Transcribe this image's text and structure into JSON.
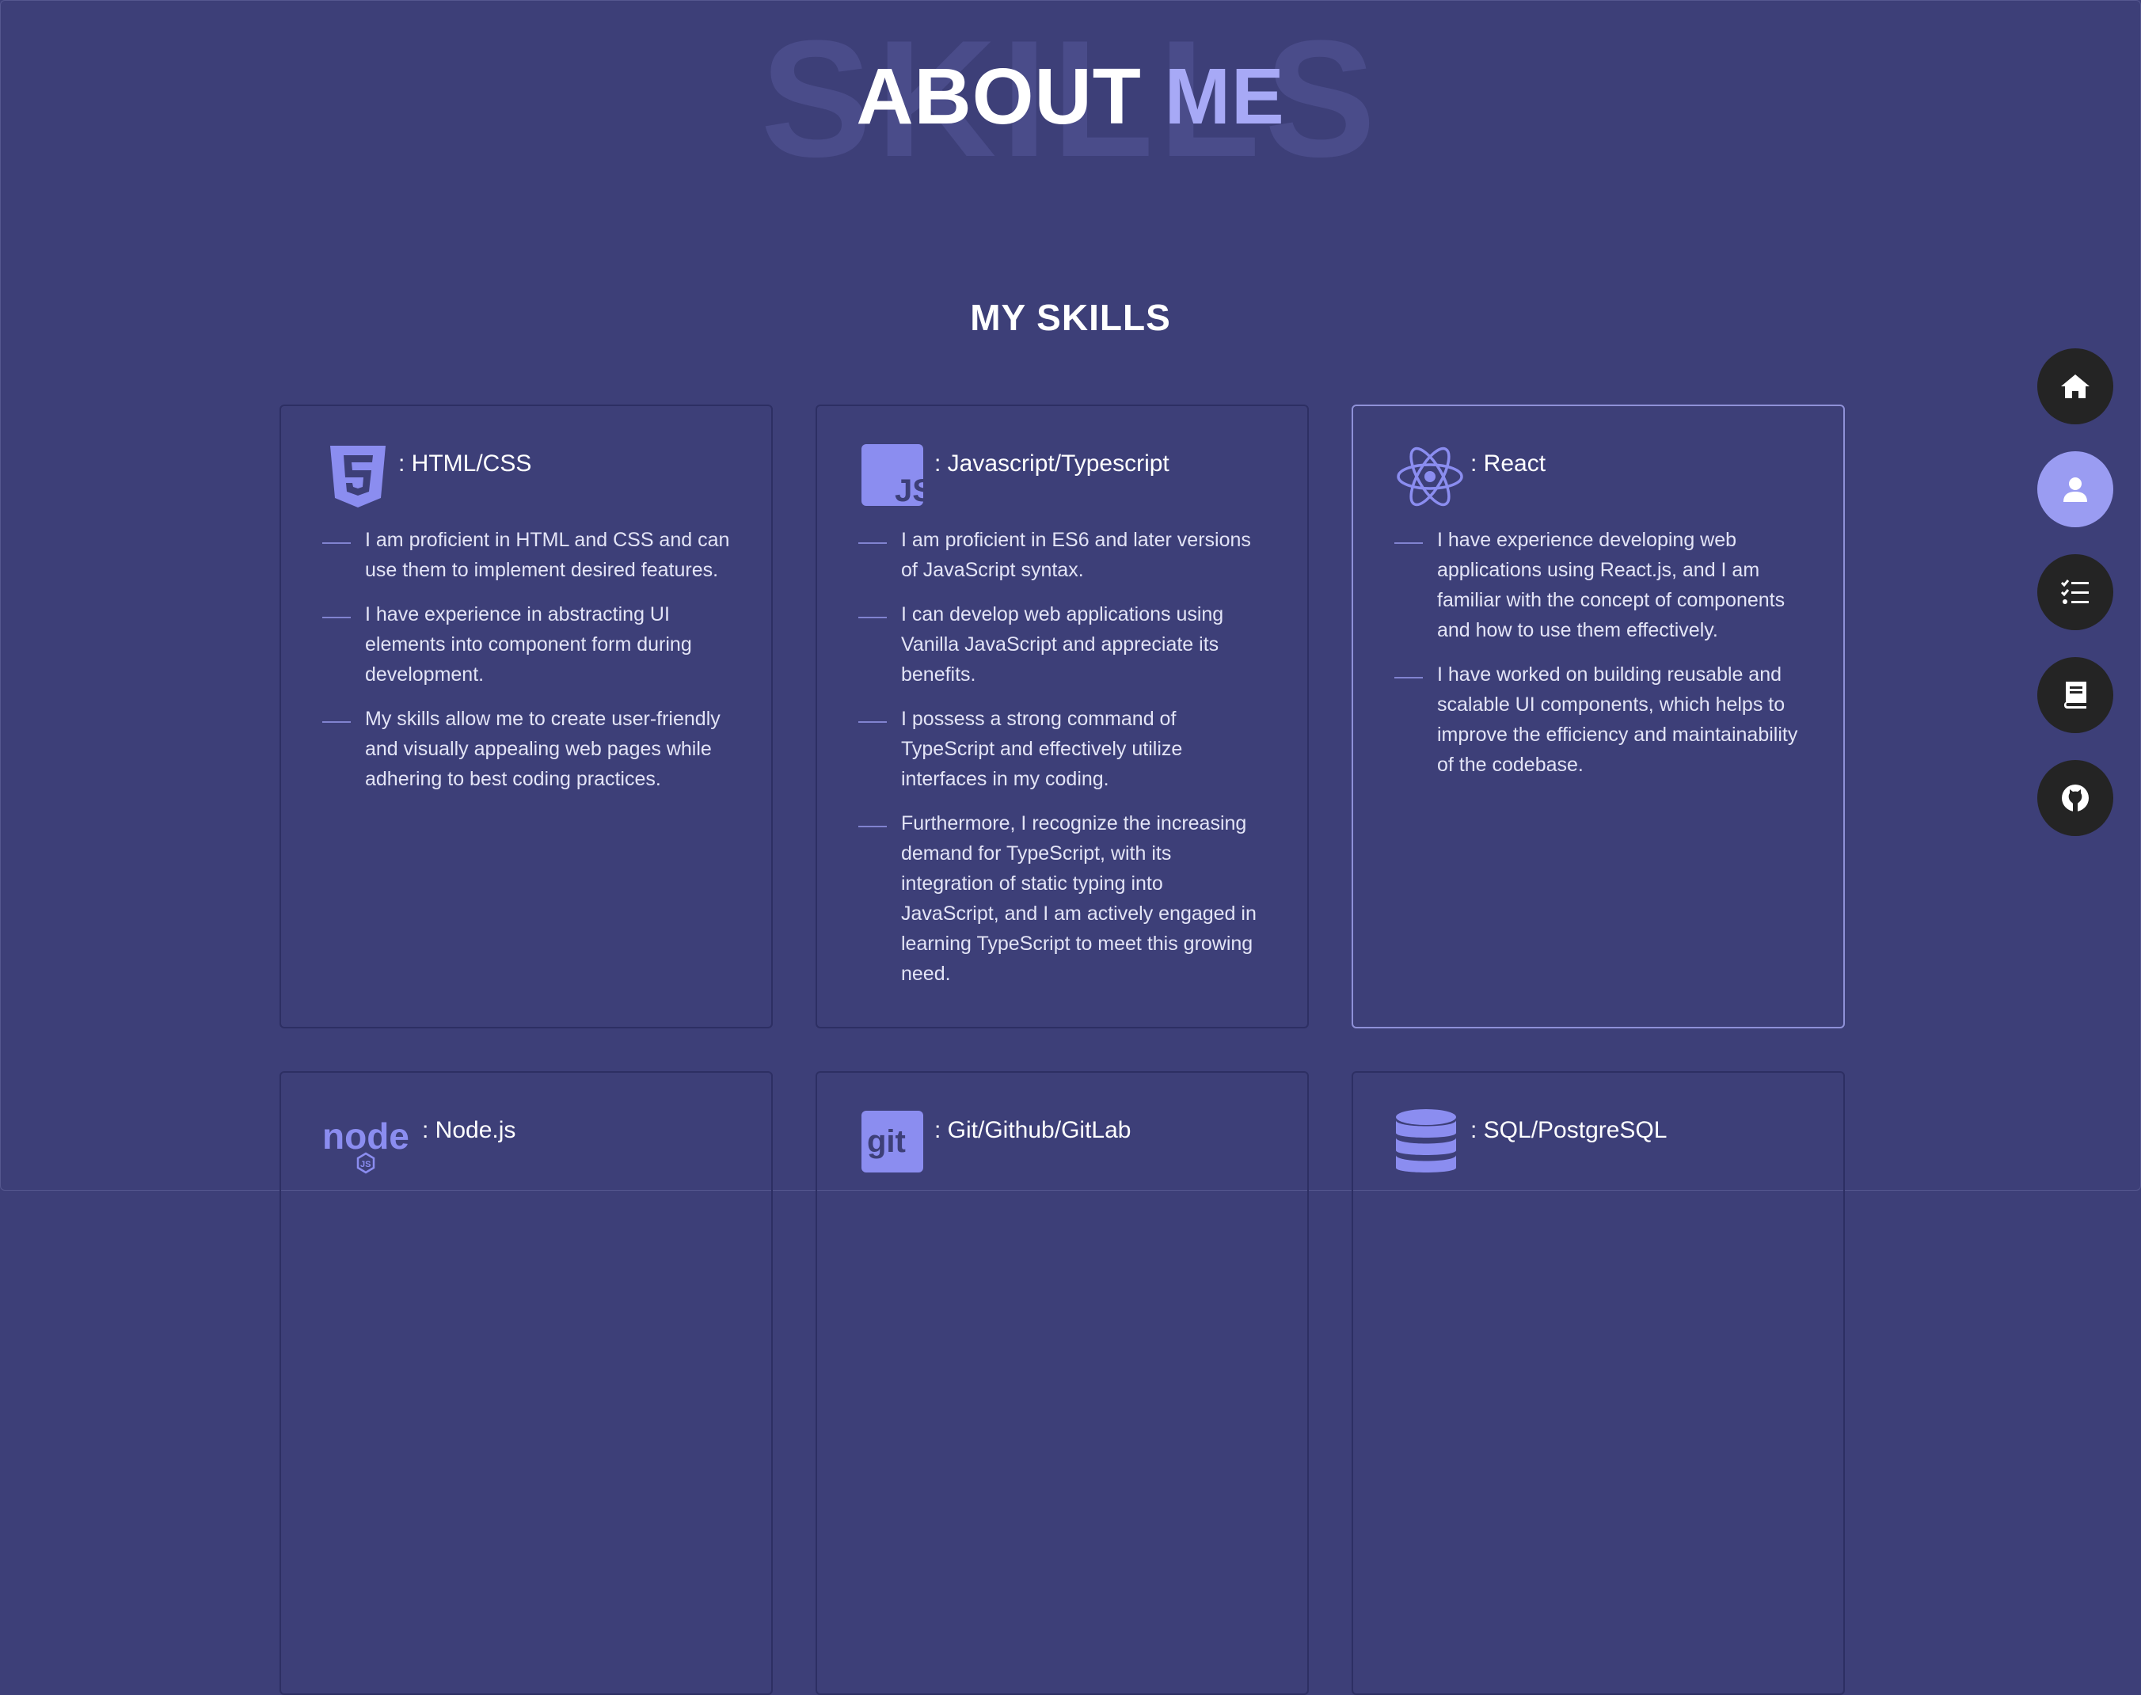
{
  "header": {
    "background_word": "SKILLS",
    "title_part1": "ABOUT",
    "title_part2": "ME"
  },
  "section_title": "MY SKILLS",
  "colors": {
    "background": "#3d3f78",
    "accent": "#a7a9f6",
    "card_border_active": "#8f91d8",
    "nav_button": "#242424",
    "nav_button_active": "#9a9cf2"
  },
  "skills": [
    {
      "icon": "html5-icon",
      "title": ": HTML/CSS",
      "items": [
        "I am proficient in HTML and CSS and can use them to implement desired features.",
        "I have experience in abstracting UI elements into component form during development.",
        "My skills allow me to create user-friendly and visually appealing web pages while adhering to best coding practices."
      ]
    },
    {
      "icon": "javascript-icon",
      "title": ": Javascript/Typescript",
      "items": [
        "I am proficient in ES6 and later versions of JavaScript syntax.",
        "I can develop web applications using Vanilla JavaScript and appreciate its benefits.",
        "I possess a strong command of TypeScript and effectively utilize interfaces in my coding.",
        "Furthermore, I recognize the increasing demand for TypeScript, with its integration of static typing into JavaScript, and I am actively engaged in learning TypeScript to meet this growing need."
      ]
    },
    {
      "icon": "react-icon",
      "title": ": React",
      "items": [
        "I have experience developing web applications using React.js, and I am familiar with the concept of components and how to use them effectively.",
        "I have worked on building reusable and scalable UI components, which helps to improve the efficiency and maintainability of the codebase."
      ]
    },
    {
      "icon": "nodejs-icon",
      "title": ": Node.js",
      "items": []
    },
    {
      "icon": "git-icon",
      "title": ": Git/Github/GitLab",
      "items": []
    },
    {
      "icon": "database-icon",
      "title": ": SQL/PostgreSQL",
      "items": []
    }
  ],
  "nav": [
    {
      "icon": "home-icon",
      "active": false
    },
    {
      "icon": "user-icon",
      "active": true
    },
    {
      "icon": "checklist-icon",
      "active": false
    },
    {
      "icon": "book-icon",
      "active": false
    },
    {
      "icon": "github-icon",
      "active": false
    }
  ]
}
